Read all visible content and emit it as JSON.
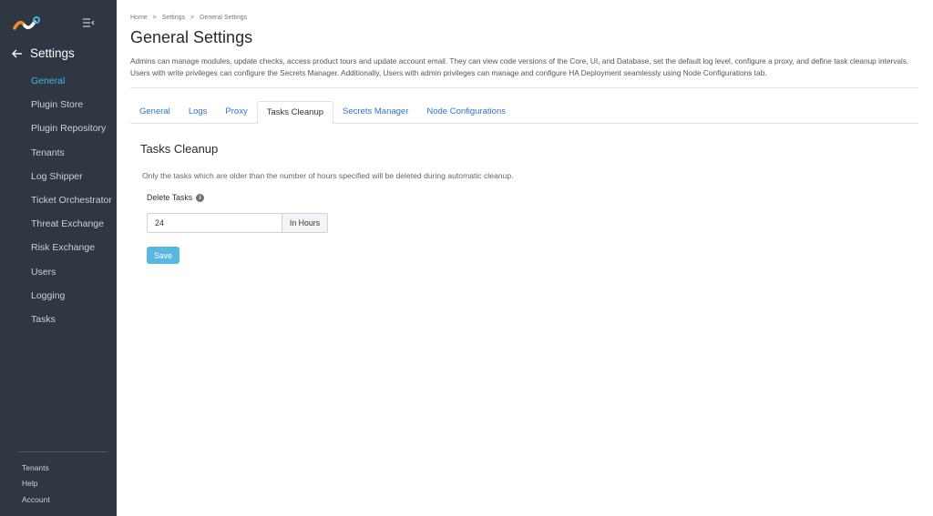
{
  "sidebar": {
    "logo_icon": "brand-logo-icon",
    "collapse_icon": "collapse-menu-icon",
    "back_icon": "arrow-left-icon",
    "title": "Settings",
    "items": [
      {
        "label": "General",
        "active": true
      },
      {
        "label": "Plugin Store"
      },
      {
        "label": "Plugin Repository"
      },
      {
        "label": "Tenants"
      },
      {
        "label": "Log Shipper"
      },
      {
        "label": "Ticket Orchestrator"
      },
      {
        "label": "Threat Exchange"
      },
      {
        "label": "Risk Exchange"
      },
      {
        "label": "Users"
      },
      {
        "label": "Logging"
      },
      {
        "label": "Tasks"
      }
    ],
    "footer": [
      "Tenants",
      "Help",
      "Account"
    ]
  },
  "breadcrumb": [
    "Home",
    ">",
    "Settings",
    ">",
    "General Settings"
  ],
  "page_title": "General Settings",
  "description": "Admins can manage modules, update checks, access product tours and update account email. They can view code versions of the Core, UI, and Database, set the default log level, configure a proxy, and define task cleanup intervals. Users with write privileges can configure the Secrets Manager. Additionally, Users with admin privileges can manage and configure HA Deployment seamlessly using Node Configurations tab.",
  "tabs": [
    "General",
    "Logs",
    "Proxy",
    "Tasks Cleanup",
    "Secrets Manager",
    "Node Configurations"
  ],
  "active_tab": "Tasks Cleanup",
  "cleanup": {
    "title": "Tasks Cleanup",
    "note": "Only the tasks which are older than the number of hours specified will be deleted during automatic cleanup.",
    "field_label": "Delete Tasks",
    "info_icon": "info-icon",
    "value": "24",
    "unit": "In Hours",
    "save_label": "Save"
  },
  "colors": {
    "sidebar_bg": "#2f3842",
    "accent": "#46b3e0",
    "link": "#2f74c8",
    "button": "#58b8df"
  }
}
